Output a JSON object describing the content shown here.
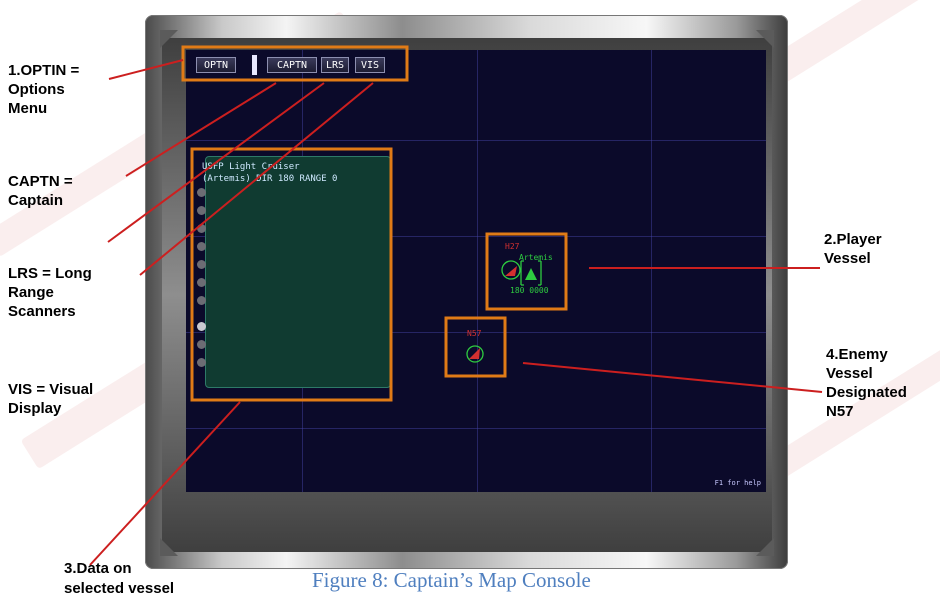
{
  "toolbar": {
    "optn_label": "OPTN",
    "captn_label": "CAPTN",
    "lrs_label": "LRS",
    "vis_label": "VIS"
  },
  "data_panel": {
    "line1": "USFP Light Cruiser",
    "line2": "(Artemis) DIR 180 RANGE 0"
  },
  "player_vessel": {
    "code": "H27",
    "name": "Artemis",
    "readout": "180  0000"
  },
  "enemy_vessel": {
    "code": "N57"
  },
  "help_text": "F1 for help",
  "annotations": {
    "optin": "1.OPTIN =\nOptions\nMenu",
    "captn": "CAPTN =\nCaptain",
    "lrs": "LRS = Long\nRange\nScanners",
    "vis": "VIS = Visual\nDisplay",
    "data": "3.Data on\nselected vessel",
    "player": "2.Player\nVessel",
    "enemy": "4.Enemy\nVessel\nDesignated\nN57"
  },
  "caption": "Figure 8: Captain’s Map Console",
  "colors": {
    "highlight_orange": "#e07b16",
    "caption_blue": "#4f7fbf",
    "map_background": "#0b0a2a",
    "player_green": "#2ecc40",
    "enemy_red": "#d33030",
    "leader_line_red": "#cc1f1f"
  }
}
